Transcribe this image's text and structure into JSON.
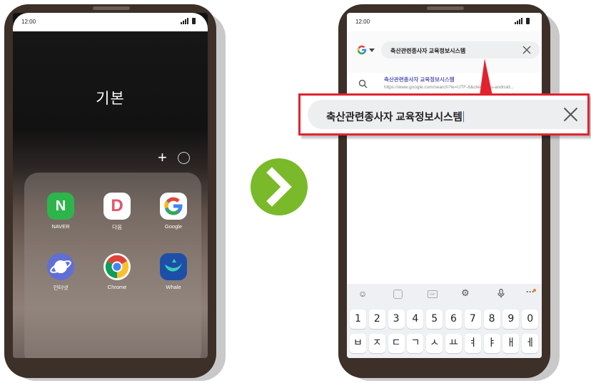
{
  "status_time": "12:00",
  "left_phone": {
    "folder_title": "기본",
    "plus_icon": "+",
    "apps": [
      {
        "label": "NAVER",
        "icon": "naver-icon",
        "glyph": "N",
        "color": "#2db54b"
      },
      {
        "label": "다음",
        "icon": "daum-icon",
        "glyph": "D",
        "color": "#ffffff"
      },
      {
        "label": "Google",
        "icon": "google-icon",
        "glyph": "G",
        "color": "#ffffff"
      },
      {
        "label": "인터넷",
        "icon": "samsung-internet-icon",
        "glyph": "",
        "color": "#5f6fd6"
      },
      {
        "label": "Chrome",
        "icon": "chrome-icon",
        "glyph": "",
        "color": "#ffffff"
      },
      {
        "label": "Whale",
        "icon": "whale-icon",
        "glyph": "",
        "color": "#1e4fa8"
      }
    ]
  },
  "right_phone": {
    "search_query": "축산관련종사자 교육정보시스템",
    "suggestion": {
      "title": "축산관련종사자 교육정보시스템",
      "url": "https://www.google.com/search?ie=UTF-8&client=ms-android..."
    },
    "keyboard": {
      "toolbar": [
        "emoji-icon",
        "sticker-icon",
        "gif-icon",
        "settings-icon",
        "mic-icon",
        "more-icon"
      ],
      "gif_label": "GIF",
      "number_row": [
        "1",
        "2",
        "3",
        "4",
        "5",
        "6",
        "7",
        "8",
        "9",
        "0"
      ],
      "letter_row": [
        "ㅂ",
        "ㅈ",
        "ㄷ",
        "ㄱ",
        "ㅅ",
        "ㅛ",
        "ㅕ",
        "ㅑ",
        "ㅐ",
        "ㅔ"
      ]
    }
  },
  "callout": {
    "text": "축산관련종사자 교육정보시스템",
    "border_color": "#e2232d"
  },
  "arrow_color": "#7ab929"
}
